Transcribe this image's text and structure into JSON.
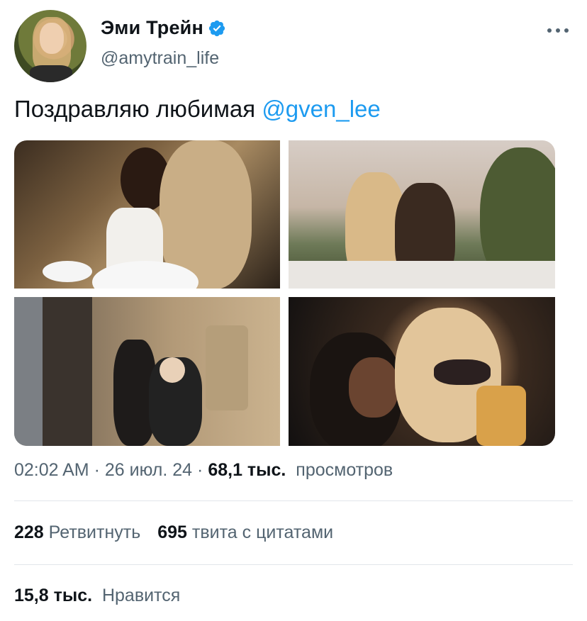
{
  "author": {
    "display_name": "Эми Трейн",
    "handle": "@amytrain_life",
    "verified": true,
    "verified_icon": "verified-badge-icon",
    "verified_color": "#1d9bf0"
  },
  "tweet": {
    "text": "Поздравляю любимая ",
    "mention": "@gven_lee",
    "mention_color": "#1d9bf0",
    "media_count": 4
  },
  "meta": {
    "time": "02:02 AM",
    "sep1": "·",
    "date": "26 июл. 24",
    "sep2": "·",
    "views_count": "68,1 тыс.",
    "views_label": "просмотров"
  },
  "stats": {
    "retweets_count": "228",
    "retweets_label": "Ретвитнуть",
    "quotes_count": "695",
    "quotes_label": "твита с цитатами",
    "likes_count": "15,8 тыс.",
    "likes_label": "Нравится"
  },
  "icons": {
    "more": "more-options-icon"
  }
}
